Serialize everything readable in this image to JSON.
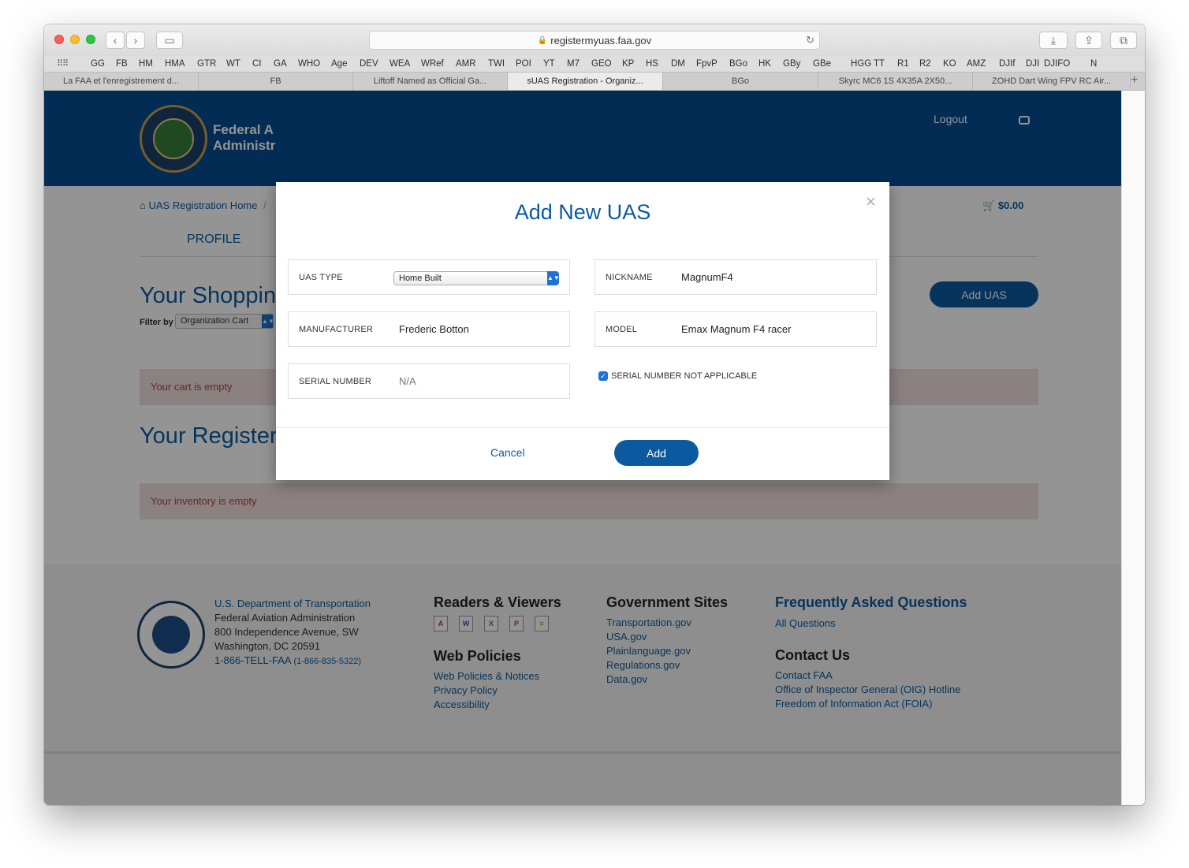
{
  "browser": {
    "url": "registermyuas.faa.gov",
    "bookmarks": [
      "GG",
      "FB",
      "HM",
      "HMA",
      "GTR",
      "WT",
      "CI",
      "GA",
      "WHO",
      "Age",
      "DEV",
      "WEA",
      "WRef",
      "AMR",
      "TWI",
      "POI",
      "YT",
      "M7",
      "GEO",
      "KP",
      "HS",
      "DM",
      "FpvP",
      "BGo",
      "HK",
      "GBy",
      "GBe",
      "HGG",
      "TT",
      "R1",
      "R2",
      "KO",
      "AMZ",
      "DJIf",
      "DJI",
      "DJIFO",
      "N"
    ],
    "tabs": [
      {
        "label": "La FAA et l'enregistrement d...",
        "active": false
      },
      {
        "label": "FB",
        "active": false
      },
      {
        "label": "Liftoff Named as Official Ga...",
        "active": false
      },
      {
        "label": "sUAS Registration - Organiz...",
        "active": true
      },
      {
        "label": "BGo",
        "active": false
      },
      {
        "label": "Skyrc MC6 1S 4X35A 2X50...",
        "active": false
      },
      {
        "label": "ZOHD Dart Wing FPV RC Air...",
        "active": false
      }
    ]
  },
  "header": {
    "org_line1": "Federal A",
    "org_line2": "Administr",
    "logout": "Logout"
  },
  "breadcrumb": {
    "home": "UAS Registration Home",
    "sep": "/"
  },
  "cart_total": "$0.00",
  "profile_tab": "PROFILE",
  "shopping": {
    "title": "Your Shoppin",
    "filter_label": "Filter by",
    "filter_value": "Organization Cart",
    "add_button": "Add UAS",
    "empty": "Your cart is empty"
  },
  "inventory": {
    "title": "Your Registered Inventory",
    "empty": "Your inventory is empty"
  },
  "footer": {
    "dot_link": "U.S. Department of Transportation",
    "agency": "Federal Aviation Administration",
    "address1": "800 Independence Avenue, SW",
    "address2": "Washington, DC 20591",
    "phone": "1-866-TELL-FAA",
    "phone_num": "(1-866-835-5322)",
    "readers_title": "Readers & Viewers",
    "web_policies_title": "Web Policies",
    "web_policies": [
      "Web Policies & Notices",
      "Privacy Policy",
      "Accessibility"
    ],
    "gov_title": "Government Sites",
    "gov_links": [
      "Transportation.gov",
      "USA.gov",
      "Plainlanguage.gov",
      "Regulations.gov",
      "Data.gov"
    ],
    "faq_title": "Frequently Asked Questions",
    "faq_link": "All Questions",
    "contact_title": "Contact Us",
    "contact_links": [
      "Contact FAA",
      "Office of Inspector General (OIG) Hotline",
      "Freedom of Information Act (FOIA)"
    ]
  },
  "modal": {
    "title": "Add New UAS",
    "close": "×",
    "uas_type_label": "UAS TYPE",
    "uas_type_value": "Home Built",
    "nickname_label": "NICKNAME",
    "nickname_value": "MagnumF4",
    "manufacturer_label": "MANUFACTURER",
    "manufacturer_value": "Frederic Botton",
    "model_label": "MODEL",
    "model_value": "Emax Magnum F4 racer",
    "serial_label": "SERIAL NUMBER",
    "serial_value": "N/A",
    "serial_na_label": "SERIAL NUMBER NOT APPLICABLE",
    "serial_na_checked": true,
    "cancel": "Cancel",
    "add": "Add"
  }
}
